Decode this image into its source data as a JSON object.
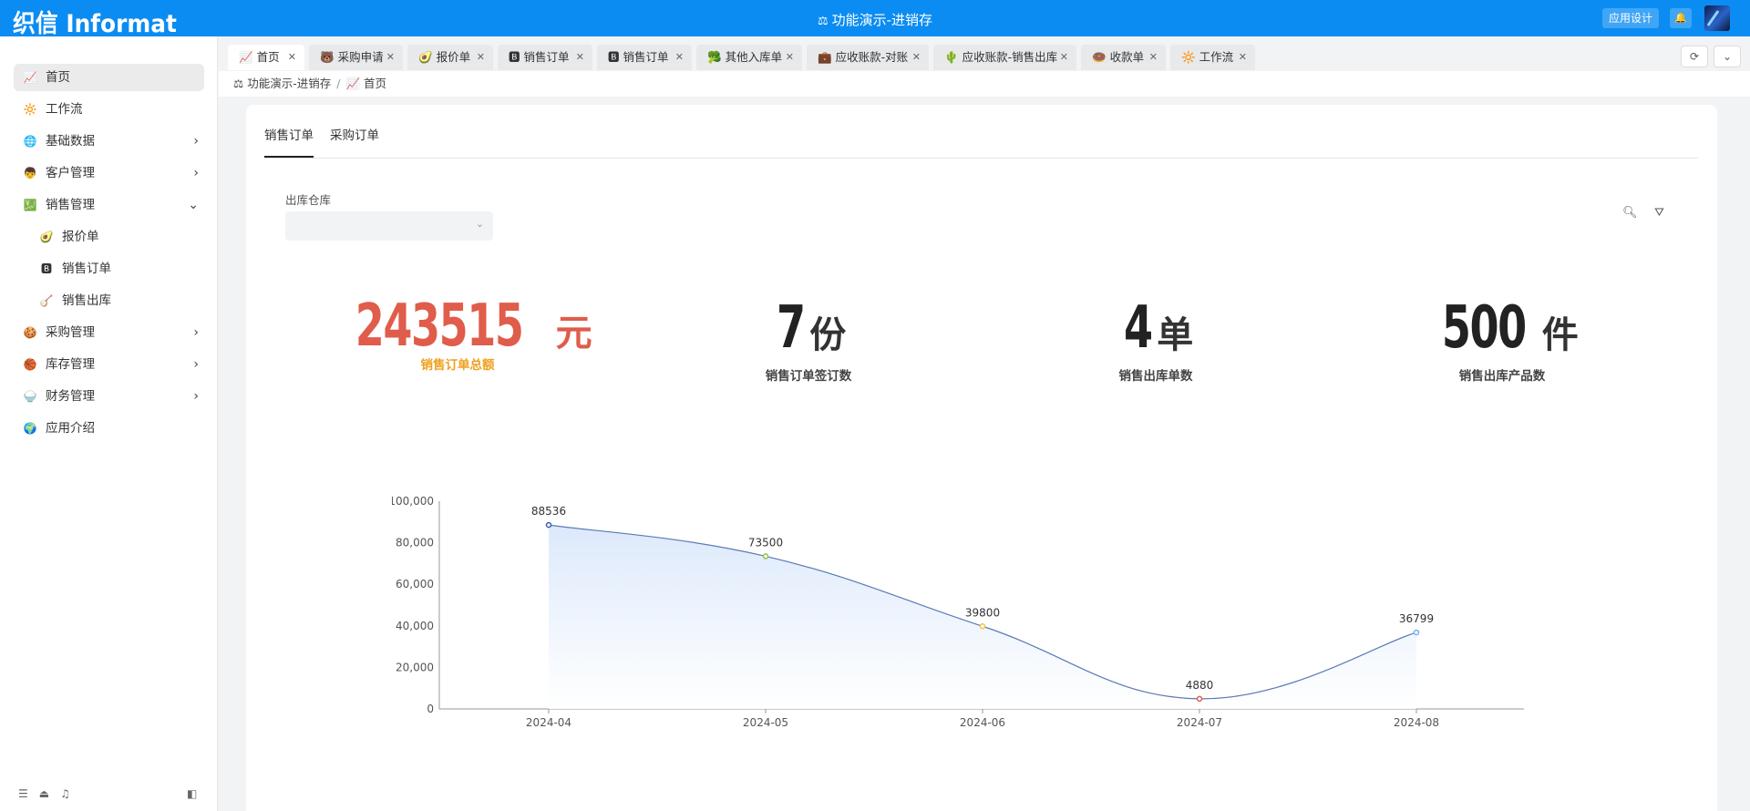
{
  "header": {
    "logo": "织信 Informat",
    "title": "功能演示-进销存",
    "title_icon": "scale-icon",
    "design_button": "应用设计",
    "bell_icon": "bell-icon"
  },
  "sidebar": {
    "items": [
      {
        "icon": "📈",
        "label": "首页",
        "active": true,
        "chevron": ""
      },
      {
        "icon": "🔆",
        "label": "工作流",
        "chevron": ""
      },
      {
        "icon": "🌐",
        "label": "基础数据",
        "chevron": "›"
      },
      {
        "icon": "👦",
        "label": "客户管理",
        "chevron": "›"
      },
      {
        "icon": "💹",
        "label": "销售管理",
        "chevron": "⌄"
      },
      {
        "icon": "🥑",
        "label": "报价单",
        "sub": true,
        "chevron": ""
      },
      {
        "icon": "🅱",
        "label": "销售订单",
        "sub": true,
        "chevron": ""
      },
      {
        "icon": "🪕",
        "label": "销售出库",
        "sub": true,
        "chevron": ""
      },
      {
        "icon": "🍪",
        "label": "采购管理",
        "chevron": "›"
      },
      {
        "icon": "🏀",
        "label": "库存管理",
        "chevron": "›"
      },
      {
        "icon": "🍚",
        "label": "财务管理",
        "chevron": "›"
      },
      {
        "icon": "🌍",
        "label": "应用介绍",
        "chevron": ""
      }
    ]
  },
  "tabs": [
    {
      "icon": "📈",
      "label": "首页",
      "active": true
    },
    {
      "icon": "🐻",
      "label": "采购申请"
    },
    {
      "icon": "🥑",
      "label": "报价单"
    },
    {
      "icon": "🅱",
      "label": "销售订单"
    },
    {
      "icon": "🅱",
      "label": "销售订单"
    },
    {
      "icon": "🥦",
      "label": "其他入库单"
    },
    {
      "icon": "💼",
      "label": "应收账款-对账"
    },
    {
      "icon": "🌵",
      "label": "应收账款-销售出库"
    },
    {
      "icon": "🍩",
      "label": "收款单"
    },
    {
      "icon": "🔆",
      "label": "工作流"
    }
  ],
  "breadcrumb": {
    "root": "功能演示-进销存",
    "current_icon": "📈",
    "current": "首页"
  },
  "content_tabs": [
    {
      "label": "销售订单",
      "active": true
    },
    {
      "label": "采购订单"
    }
  ],
  "filter": {
    "label": "出库仓库",
    "value": ""
  },
  "stats": [
    {
      "value": "243515",
      "unit": "元",
      "label": "销售订单总额",
      "color": "#e05c4b"
    },
    {
      "value": "7",
      "unit": "份",
      "label": "销售订单签订数"
    },
    {
      "value": "4",
      "unit": "单",
      "label": "销售出库单数"
    },
    {
      "value": "500",
      "unit": "件",
      "label": "销售出库产品数"
    }
  ],
  "chart_data": {
    "type": "area",
    "categories": [
      "2024-04",
      "2024-05",
      "2024-06",
      "2024-07",
      "2024-08"
    ],
    "values": [
      88536,
      73500,
      39800,
      4880,
      36799
    ],
    "point_colors": [
      "#3b5ea8",
      "#8bc34a",
      "#f5c542",
      "#e05c4b",
      "#6fb3e8"
    ],
    "ylim": [
      0,
      100000
    ],
    "yticks": [
      "100,000",
      "80,000",
      "60,000",
      "40,000",
      "20,000",
      "0"
    ],
    "line_color": "#5b7ab5",
    "fill_color": "#dce9fb"
  }
}
